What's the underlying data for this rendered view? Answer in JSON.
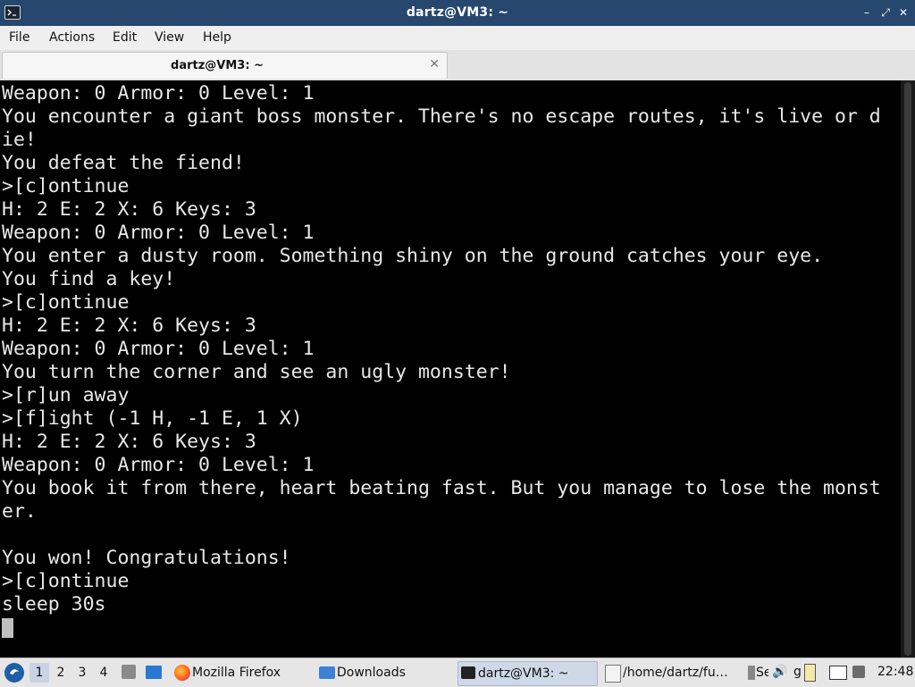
{
  "window": {
    "title": "dartz@VM3: ~",
    "controls": {
      "minimize": "–",
      "maximize": "⤢",
      "close": "✕"
    }
  },
  "menu": [
    "File",
    "Actions",
    "Edit",
    "View",
    "Help"
  ],
  "tab": {
    "label": "dartz@VM3: ~",
    "close": "✕"
  },
  "terminal": {
    "lines": [
      "Weapon: 0 Armor: 0 Level: 1",
      "You encounter a giant boss monster. There's no escape routes, it's live or d",
      "ie!",
      "You defeat the fiend!",
      ">[c]ontinue",
      "H: 2 E: 2 X: 6 Keys: 3",
      "Weapon: 0 Armor: 0 Level: 1",
      "You enter a dusty room. Something shiny on the ground catches your eye.",
      "You find a key!",
      ">[c]ontinue",
      "H: 2 E: 2 X: 6 Keys: 3",
      "Weapon: 0 Armor: 0 Level: 1",
      "You turn the corner and see an ugly monster!",
      ">[r]un away",
      ">[f]ight (-1 H, -1 E, 1 X)",
      "H: 2 E: 2 X: 6 Keys: 3",
      "Weapon: 0 Armor: 0 Level: 1",
      "You book it from there, heart beating fast. But you manage to lose the monst",
      "er.",
      "",
      "You won! Congratulations!",
      ">[c]ontinue",
      "sleep 30s"
    ]
  },
  "taskbar": {
    "workspaces": [
      "1",
      "2",
      "3",
      "4"
    ],
    "tasks": [
      {
        "label": "Mozilla Firefox",
        "icon": "firefox-icon"
      },
      {
        "label": "Downloads",
        "icon": "folder-icon"
      },
      {
        "label": "dartz@VM3: ~",
        "icon": "terminal-icon",
        "active": true
      },
      {
        "label": "/home/dartz/fu…",
        "icon": "editor-icon"
      },
      {
        "label": "Se",
        "icon": "app-icon"
      }
    ],
    "tray_g": "g",
    "clock": "22:48"
  },
  "colors": {
    "titlebar": "#26476e",
    "terminal_bg": "#000000",
    "terminal_fg": "#e8e8e8"
  }
}
